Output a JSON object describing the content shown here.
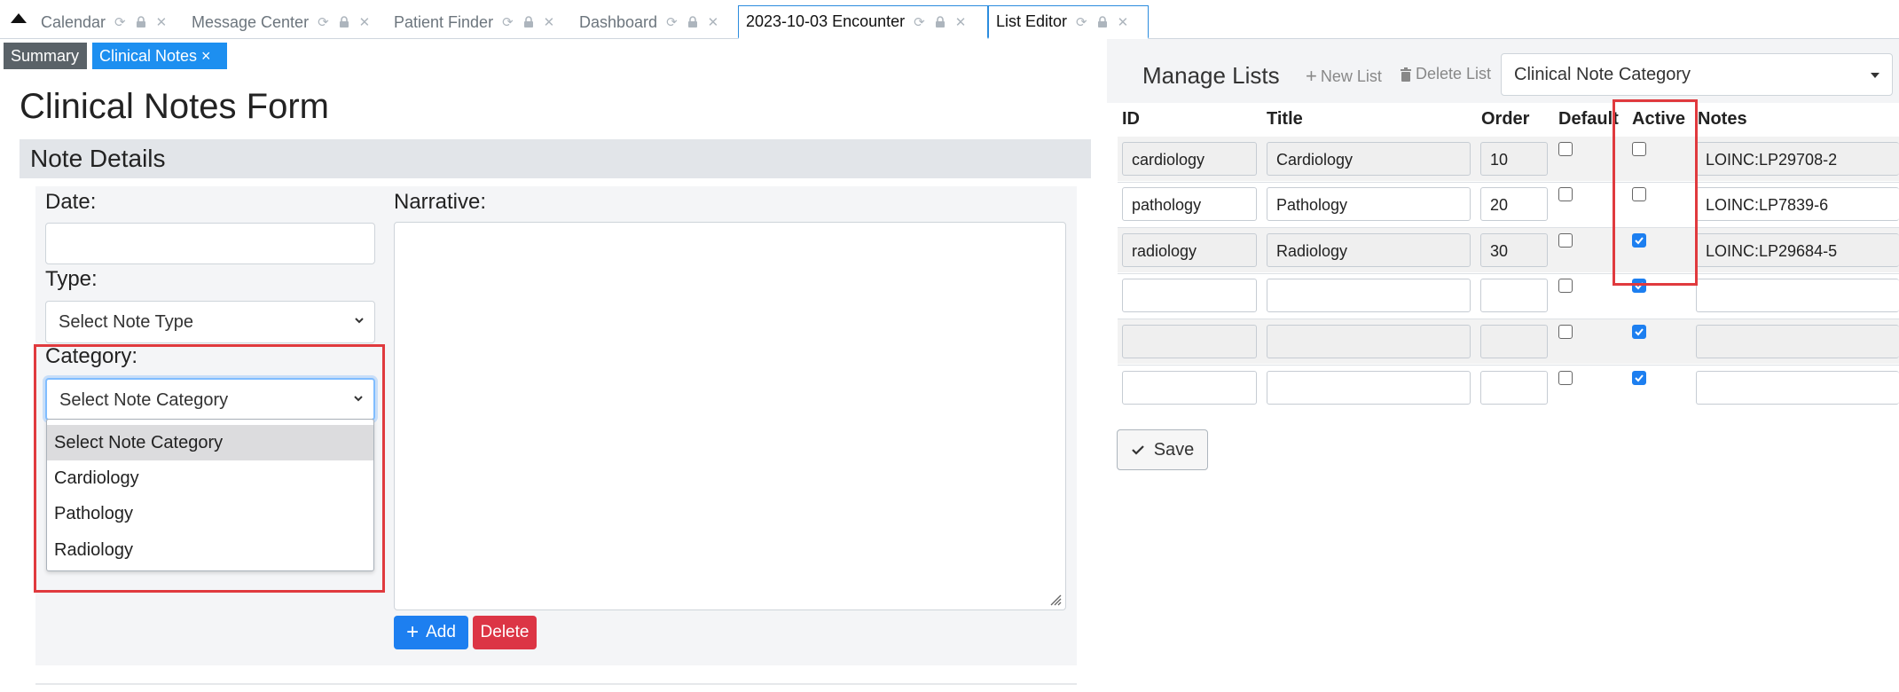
{
  "tabs": [
    {
      "label": "Calendar"
    },
    {
      "label": "Message Center"
    },
    {
      "label": "Patient Finder"
    },
    {
      "label": "Dashboard"
    },
    {
      "label": "2023-10-03 Encounter"
    },
    {
      "label": "List Editor"
    }
  ],
  "subtabs": {
    "summary": "Summary",
    "clinical_notes": "Clinical Notes ×"
  },
  "form": {
    "title": "Clinical Notes Form",
    "section": "Note Details",
    "date_label": "Date:",
    "type_label": "Type:",
    "type_value": "Select Note Type",
    "category_label": "Category:",
    "category_value": "Select Note Category",
    "category_options": [
      "Select Note Category",
      "Cardiology",
      "Pathology",
      "Radiology"
    ],
    "narrative_label": "Narrative:",
    "add_label": "Add",
    "delete_label": "Delete"
  },
  "list_editor": {
    "title": "Manage Lists",
    "new_list": "New List",
    "delete_list": "Delete List",
    "selected_list": "Clinical Note Category",
    "columns": [
      "ID",
      "Title",
      "Order",
      "Default",
      "Active",
      "Notes"
    ],
    "rows": [
      {
        "id": "cardiology",
        "title": "Cardiology",
        "order": "10",
        "default": false,
        "active": false,
        "notes": "LOINC:LP29708-2"
      },
      {
        "id": "pathology",
        "title": "Pathology",
        "order": "20",
        "default": false,
        "active": false,
        "notes": "LOINC:LP7839-6"
      },
      {
        "id": "radiology",
        "title": "Radiology",
        "order": "30",
        "default": false,
        "active": true,
        "notes": "LOINC:LP29684-5"
      },
      {
        "id": "",
        "title": "",
        "order": "",
        "default": false,
        "active": true,
        "notes": ""
      },
      {
        "id": "",
        "title": "",
        "order": "",
        "default": false,
        "active": true,
        "notes": ""
      },
      {
        "id": "",
        "title": "",
        "order": "",
        "default": false,
        "active": true,
        "notes": ""
      }
    ],
    "save_label": "Save"
  },
  "colors": {
    "accent": "#1d8ff0",
    "danger": "#dc3545",
    "highlight": "#e03a3e"
  }
}
